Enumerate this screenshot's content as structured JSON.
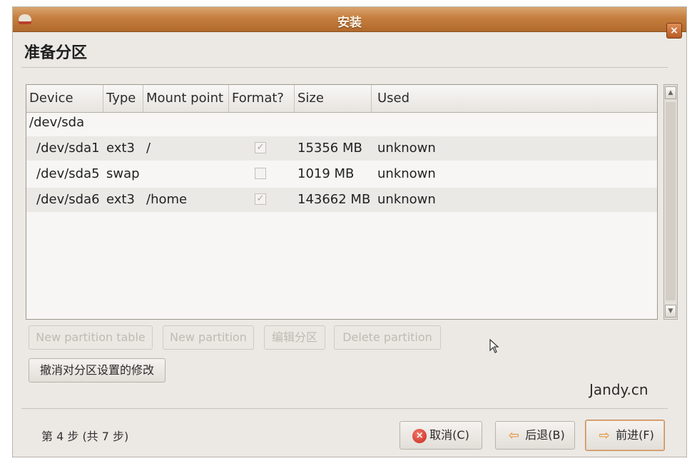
{
  "window": {
    "title": "安装"
  },
  "page": {
    "heading": "准备分区"
  },
  "table": {
    "columns": [
      "Device",
      "Type",
      "Mount point",
      "Format?",
      "Size",
      "Used"
    ],
    "disk": "/dev/sda",
    "rows": [
      {
        "device": "/dev/sda1",
        "type": "ext3",
        "mount": "/",
        "format": true,
        "size": "15356 MB",
        "used": "unknown"
      },
      {
        "device": "/dev/sda5",
        "type": "swap",
        "mount": "",
        "format": false,
        "size": "1019 MB",
        "used": "unknown"
      },
      {
        "device": "/dev/sda6",
        "type": "ext3",
        "mount": "/home",
        "format": true,
        "size": "143662 MB",
        "used": "unknown"
      }
    ]
  },
  "actions": {
    "new_partition_table": "New partition table",
    "new_partition": "New partition",
    "edit_partition": "编辑分区",
    "delete_partition": "Delete partition",
    "revert": "撤消对分区设置的修改"
  },
  "footer": {
    "step": "第 4 步 (共 7 步)",
    "cancel": "取消(C)",
    "back": "后退(B)",
    "forward": "前进(F)"
  },
  "watermark": "Jandy.cn",
  "icons": {
    "cancel": "cancel-icon",
    "back": "back-arrow-icon",
    "forward": "forward-arrow-icon",
    "close": "close-icon"
  }
}
